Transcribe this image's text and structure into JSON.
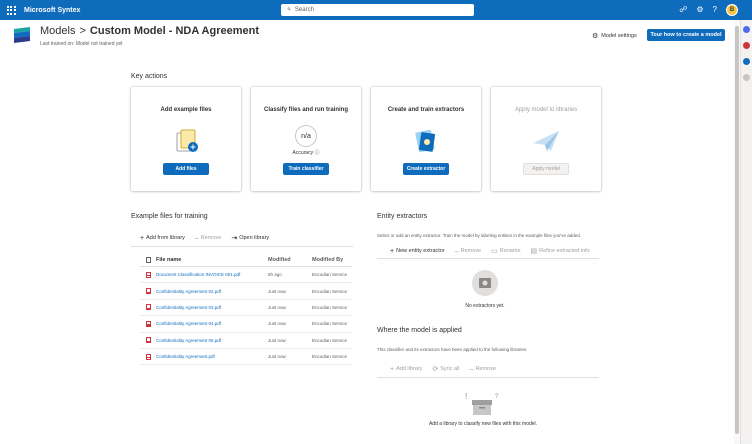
{
  "topbar": {
    "app_name": "Microsoft Syntex",
    "search_placeholder": "Search",
    "avatar_initials": "B"
  },
  "header": {
    "breadcrumb_root": "Models",
    "breadcrumb_sep": ">",
    "title": "Custom Model - NDA Agreement",
    "last_trained": "Last trained on: Model not trained yet",
    "settings_label": "Model settings",
    "tour_button": "Tour how to create a model"
  },
  "key_actions": {
    "heading": "Key actions",
    "cards": [
      {
        "title": "Add example files",
        "button": "Add files",
        "enabled": true
      },
      {
        "title": "Classify files and run training",
        "button": "Train classifier",
        "enabled": true,
        "metric_value": "n/a",
        "metric_label": "Accuracy"
      },
      {
        "title": "Create and train extractors",
        "button": "Create extractor",
        "enabled": true
      },
      {
        "title": "Apply model to libraries",
        "button": "Apply model",
        "enabled": false
      }
    ]
  },
  "example_files": {
    "heading": "Example files for training",
    "toolbar": {
      "add": "Add from library",
      "remove": "Remove",
      "open": "Open library"
    },
    "columns": {
      "name": "File name",
      "modified": "Modified",
      "modified_by": "Modified By"
    },
    "rows": [
      {
        "name": "Document Classification INVOICE 001.pdf",
        "modified": "5h ago",
        "modified_by": "Encodian Service"
      },
      {
        "name": "Confidentiality Agreement 02.pdf",
        "modified": "Just now",
        "modified_by": "Encodian Service"
      },
      {
        "name": "Confidentiality Agreement 03.pdf",
        "modified": "Just now",
        "modified_by": "Encodian Service"
      },
      {
        "name": "Confidentiality Agreement 04.pdf",
        "modified": "Just now",
        "modified_by": "Encodian Service"
      },
      {
        "name": "Confidentiality Agreement 05.pdf",
        "modified": "Just now",
        "modified_by": "Encodian Service"
      },
      {
        "name": "Confidentiality Agreement.pdf",
        "modified": "Just now",
        "modified_by": "Encodian Service"
      }
    ]
  },
  "entity_extractors": {
    "heading": "Entity extractors",
    "description": "Select or add an entity extractor. Train the model by labeling entities in the example files you've added.",
    "toolbar": {
      "new": "New entity extractor",
      "remove": "Remove",
      "rename": "Rename",
      "refine": "Refine extracted info"
    },
    "empty": "No extractors yet."
  },
  "applied": {
    "heading": "Where the model is applied",
    "description": "This classifier and its extractors have been applied to the following libraries.",
    "toolbar": {
      "add": "Add library",
      "sync": "Sync all",
      "remove": "Remove"
    },
    "empty": "Add a library to classify new files with this model."
  },
  "colors": {
    "brand": "#0f6cbd",
    "disabled": "#a19f9d"
  }
}
